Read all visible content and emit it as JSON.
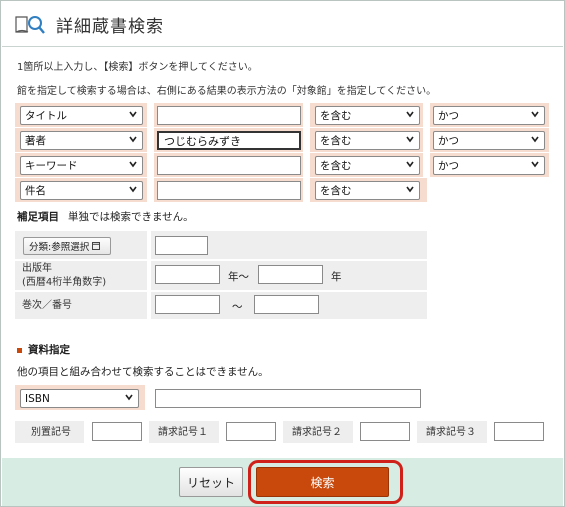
{
  "header": {
    "title": "詳細蔵書検索"
  },
  "notices": {
    "line1": "1箇所以上入力し、【検索】ボタンを押してください。",
    "line2": "館を指定して検索する場合は、右側にある結果の表示方法の「対象館」を指定してください。"
  },
  "rows": [
    {
      "field": "タイトル",
      "value": "",
      "match": "を含む",
      "op": "かつ"
    },
    {
      "field": "著者",
      "value": "つじむらみずき",
      "match": "を含む",
      "op": "かつ"
    },
    {
      "field": "キーワード",
      "value": "",
      "match": "を含む",
      "op": "かつ"
    },
    {
      "field": "件名",
      "value": "",
      "match": "を含む"
    }
  ],
  "supplement": {
    "heading": "補足項目",
    "note": "単独では検索できません。",
    "classify_button": "分類:参照選択",
    "classify_value": "",
    "pub_year_label_1": "出版年",
    "pub_year_label_2": "(西暦4桁半角数字)",
    "year_from": "",
    "year_sep": "年～",
    "year_to": "",
    "year_suffix": "年",
    "volume_label": "巻次／番号",
    "volume_from": "",
    "volume_sep": "～",
    "volume_to": ""
  },
  "material": {
    "heading": "資料指定",
    "note": "他の項目と組み合わせて検索することはできません。",
    "id_type": "ISBN",
    "id_value": "",
    "betsu_label": "別置記号",
    "betsu_value": "",
    "call1_label": "請求記号１",
    "call1_value": "",
    "call2_label": "請求記号２",
    "call2_value": "",
    "call3_label": "請求記号３",
    "call3_value": ""
  },
  "buttons": {
    "reset": "リセット",
    "search": "検索"
  },
  "colors": {
    "accent": "#c9480b",
    "highlight_ring": "#d0201a",
    "row_bg": "#f6dccf",
    "footer_bg": "#d7ece2"
  }
}
